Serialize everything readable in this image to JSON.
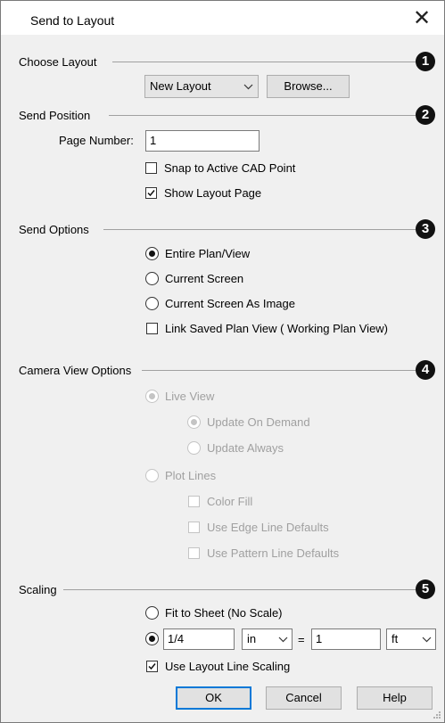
{
  "window": {
    "title": "Send to Layout",
    "close_glyph": "✕"
  },
  "choose_layout": {
    "label": "Choose Layout",
    "number": "1",
    "layout_select_value": "New Layout",
    "browse_label": "Browse..."
  },
  "send_position": {
    "label": "Send Position",
    "number": "2",
    "page_number_label": "Page Number:",
    "page_number_value": "1",
    "snap_label": "Snap to Active CAD Point",
    "snap_checked": false,
    "show_layout_label": "Show Layout Page",
    "show_layout_checked": true
  },
  "send_options": {
    "label": "Send Options",
    "number": "3",
    "entire_plan_label": "Entire Plan/View",
    "current_screen_label": "Current Screen",
    "current_screen_image_label": "Current Screen As Image",
    "link_saved_label": "Link Saved Plan View ( Working Plan View)",
    "selected": "Entire Plan/View",
    "link_saved_checked": false
  },
  "camera_view_options": {
    "label": "Camera View Options",
    "number": "4",
    "live_view_label": "Live View",
    "update_on_demand_label": "Update On Demand",
    "update_always_label": "Update Always",
    "plot_lines_label": "Plot Lines",
    "color_fill_label": "Color Fill",
    "edge_line_label": "Use Edge Line Defaults",
    "pattern_line_label": "Use Pattern Line Defaults",
    "enabled": false
  },
  "scaling": {
    "label": "Scaling",
    "number": "5",
    "fit_to_sheet_label": "Fit to Sheet (No Scale)",
    "scale_value": "1/4",
    "unit_left": "in",
    "equals": "=",
    "scale_right_value": "1",
    "unit_right": "ft",
    "use_layout_line_label": "Use Layout Line Scaling",
    "use_layout_line_checked": true,
    "selected": "custom"
  },
  "buttons": {
    "ok": "OK",
    "cancel": "Cancel",
    "help": "Help"
  },
  "colors": {
    "accent": "#0078d7",
    "dialog_bg": "#f0f0f0",
    "disabled_text": "#a0a0a0"
  },
  "icons": [
    "close-icon",
    "chevron-down-icon",
    "check-icon",
    "resize-grip-icon"
  ]
}
